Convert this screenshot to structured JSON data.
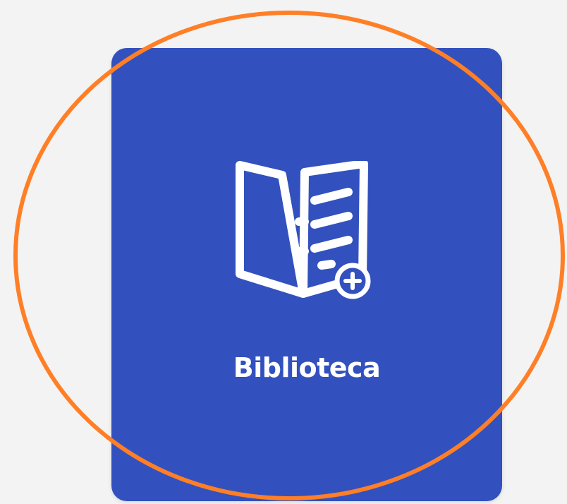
{
  "tile": {
    "label": "Biblioteca",
    "icon": "book-add-icon",
    "background_color": "#3251be",
    "foreground_color": "#ffffff"
  },
  "highlight": {
    "shape": "ellipse",
    "color": "#ff7f27"
  },
  "page": {
    "background_color": "#f3f3f3"
  }
}
